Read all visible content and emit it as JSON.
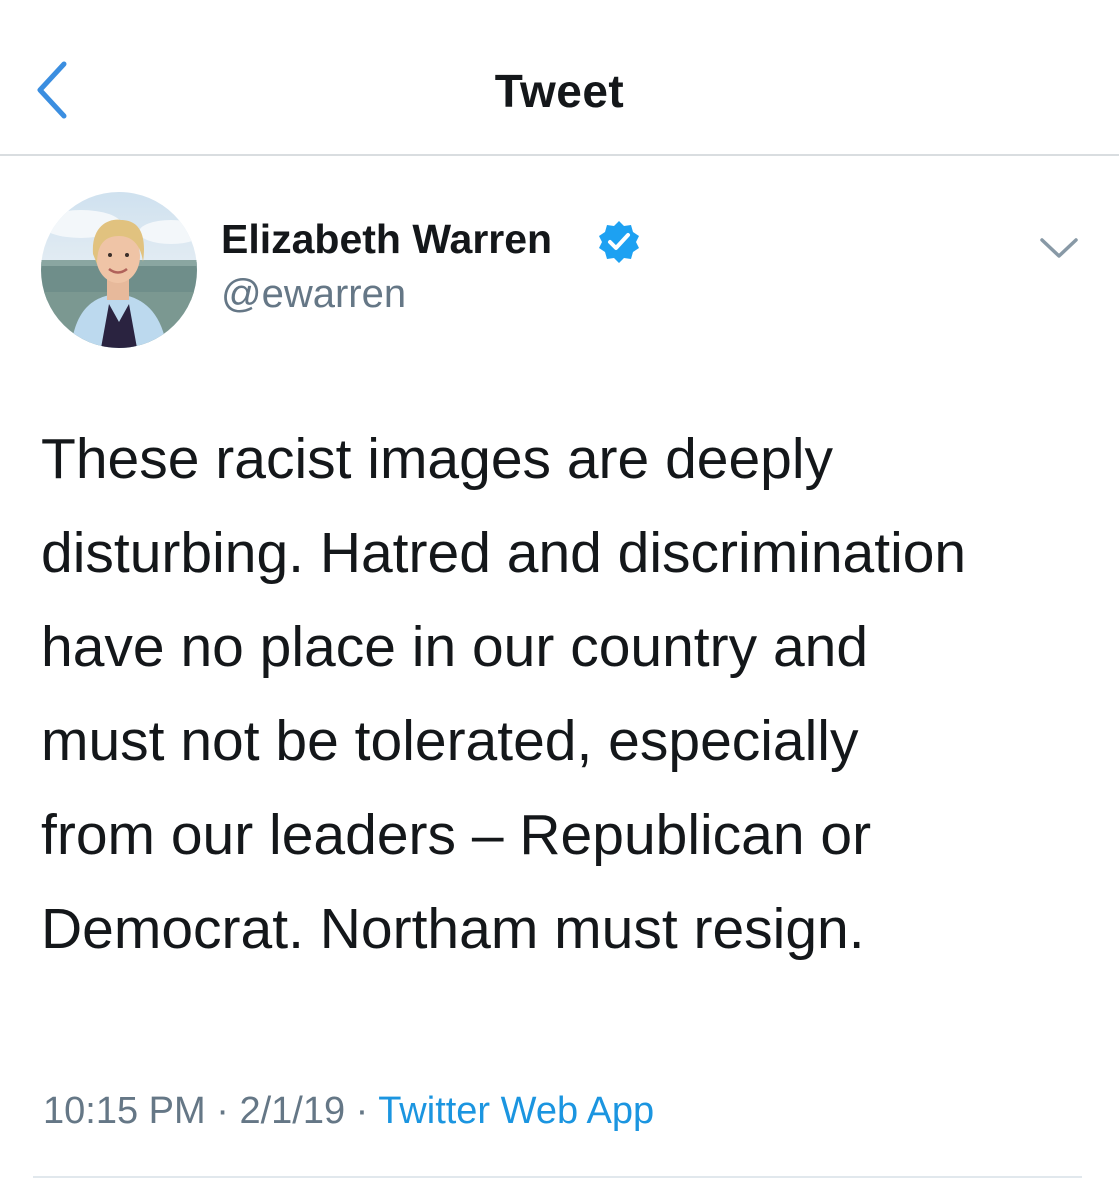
{
  "header": {
    "title": "Tweet",
    "back_icon": "chevron-left-icon"
  },
  "tweet": {
    "author": {
      "name": "Elizabeth Warren",
      "handle": "@ewarren",
      "verified": true,
      "avatar_icon": "profile-photo"
    },
    "text_lines": [
      "These racist images are deeply",
      "disturbing. Hatred and discrimination",
      "have no place in our country and",
      "must not be tolerated, especially",
      "from our leaders – Republican or",
      "Democrat. Northam must resign."
    ],
    "time": "10:15 PM",
    "date": "2/1/19",
    "source": "Twitter Web App",
    "separator": "·",
    "menu_icon": "chevron-down-icon"
  },
  "colors": {
    "accent": "#1b95e0",
    "back_arrow": "#3b8ee0",
    "text_primary": "#14171a",
    "text_secondary": "#657786",
    "verified_badge": "#1da1f2",
    "divider": "#d9dde0"
  }
}
